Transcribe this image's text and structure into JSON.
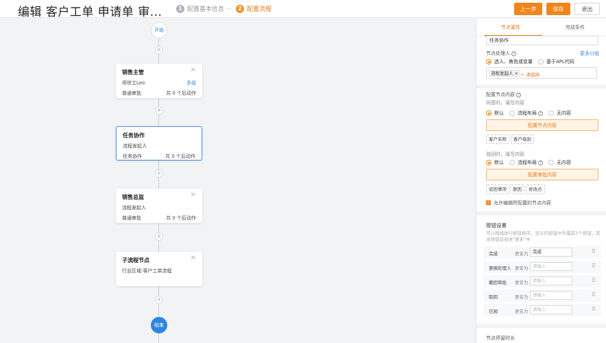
{
  "header": {
    "title": "编辑 客户工单 申请单 审...",
    "steps": [
      {
        "num": "1",
        "label": "配置基本信息"
      },
      {
        "num": "2",
        "label": "配置流程"
      }
    ],
    "step_separator": "...",
    "buttons": {
      "prev": "上一步",
      "save": "保存",
      "exit": "退出"
    }
  },
  "flow": {
    "start_label": "开始",
    "end_label": "结束",
    "plus": "+",
    "close": "✕",
    "nodes": [
      {
        "title": "销售主管",
        "sub": "师世立Leo",
        "link": "多组",
        "type": "普通审批",
        "actions": "共 0 个后动作"
      },
      {
        "title": "任务协作",
        "sub": "流程发起人",
        "link": "",
        "type": "任务协作",
        "actions": "共 0 个后动作"
      },
      {
        "title": "销售总监",
        "sub": "流程发起人",
        "link": "",
        "type": "普通审批",
        "actions": "共 0 个后动作"
      },
      {
        "title": "子流程节点",
        "sub": "行业区域-客户工单流程",
        "link": "",
        "type": "",
        "actions": ""
      }
    ]
  },
  "panel": {
    "tabs": [
      {
        "label": "节点属性",
        "active": true
      },
      {
        "label": "完成条件",
        "active": false
      }
    ],
    "node_name": "任务协作",
    "handler": {
      "label": "节点处理人",
      "more_link": "更多分组",
      "options": [
        "选人、角色或变量",
        "基于APL代码"
      ],
      "selected_tag": "流程发起人",
      "tag_remove": "×",
      "add_label": "+ 请选择"
    },
    "content": {
      "label": "配置节点内容",
      "agree": {
        "label": "同意时，填写内容",
        "options": [
          "默认",
          "流程布局",
          "无内容"
        ],
        "button": "配置节点内容",
        "chips": [
          "客户名称",
          "客户级别"
        ]
      },
      "reject": {
        "label": "驳回时，填写内容",
        "options": [
          "默认",
          "流程布局",
          "无内容"
        ],
        "button": "配置审批内容",
        "chips": [
          "驳回事项",
          "原因",
          "修改点"
        ]
      },
      "checkbox_label": "允许编辑所配置的节点内容",
      "checkbox_mark": "✓"
    },
    "button_settings": {
      "title": "按钮设置",
      "desc": "可以拖拽进行按钮排序，显示的按钮中外露前3个按钮，其余按钮会收进\"更多\"中",
      "alias_label": "更名为",
      "drag_icon": "⠿",
      "rows": [
        {
          "label": "完成",
          "value": "完成",
          "placeholder": ""
        },
        {
          "label": "更换处理人",
          "value": "",
          "placeholder": "请输入"
        },
        {
          "label": "撤回审批",
          "value": "",
          "placeholder": "请输入"
        },
        {
          "label": "取回",
          "value": "",
          "placeholder": "请输入"
        },
        {
          "label": "已阅",
          "value": "",
          "placeholder": "请输入"
        }
      ]
    },
    "bottom_label": "节点停留时长"
  }
}
